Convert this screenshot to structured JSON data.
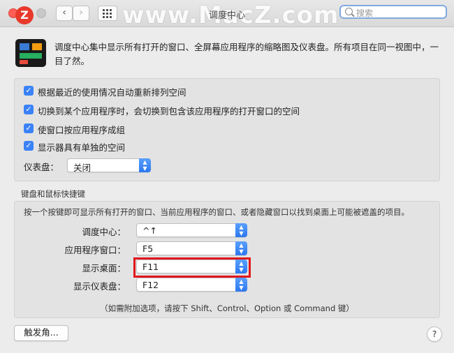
{
  "window": {
    "title": "调度中心",
    "watermark": "www.MacZ.com",
    "logo_letter": "Z",
    "search_placeholder": "搜索"
  },
  "nav": {
    "back": "‹",
    "forward": "›"
  },
  "description": "调度中心集中显示所有打开的窗口、全屏幕应用程序的缩略图及仪表盘。所有项目在同一视图中，一目了然。",
  "options": [
    {
      "label": "根据最近的使用情况自动重新排列空间",
      "checked": true
    },
    {
      "label": "切换到某个应用程序时，会切换到包含该应用程序的打开窗口的空间",
      "checked": true
    },
    {
      "label": "使窗口按应用程序成组",
      "checked": true
    },
    {
      "label": "显示器具有单独的空间",
      "checked": true
    }
  ],
  "dashboard": {
    "label": "仪表盘：",
    "value": "关闭"
  },
  "shortcuts": {
    "section_title": "键盘和鼠标快捷键",
    "description": "按一个按键即可显示所有打开的窗口、当前应用程序的窗口、或者隐藏窗口以找到桌面上可能被遮盖的项目。",
    "rows": [
      {
        "label": "调度中心：",
        "value": "^↑"
      },
      {
        "label": "应用程序窗口：",
        "value": "F5"
      },
      {
        "label": "显示桌面：",
        "value": "F11"
      },
      {
        "label": "显示仪表盘：",
        "value": "F12"
      }
    ],
    "hint": "（如需附加选项，请按下 Shift、Control、Option 或 Command 键）"
  },
  "buttons": {
    "hot_corners": "触发角...",
    "help": "?"
  },
  "colors": {
    "accent": "#3a82f7",
    "highlight": "#e0161b"
  }
}
